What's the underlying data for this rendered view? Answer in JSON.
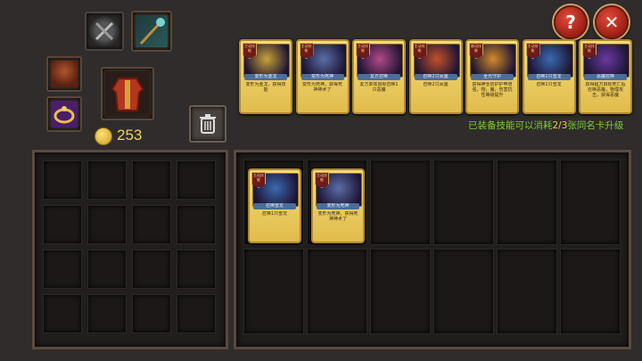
{
  "header": {
    "help_label": "?",
    "close_label": "✕"
  },
  "equipment": {
    "slots": [
      {
        "id": "weapon-slot-empty",
        "icon": "crossed-weapons-disabled-icon",
        "color": "#6f6f6f"
      },
      {
        "id": "weapon-slot-staff",
        "icon": "staff-icon",
        "color": "#3d7a7a"
      },
      {
        "id": "helmet-slot",
        "icon": "leather-helmet-icon",
        "color": "#8a3a22"
      },
      {
        "id": "armor-slot",
        "icon": "red-robe-armor-icon",
        "color": "#b3371f"
      },
      {
        "id": "ring-slot",
        "icon": "gold-ring-icon",
        "color": "#6a2c8c"
      }
    ],
    "gold_icon": "gold-coin-icon",
    "gold_amount": "253",
    "trash_icon": "trash-can-icon"
  },
  "skills_bar": {
    "cards": [
      {
        "tag": "主动技能",
        "title": "变形为金龙",
        "desc": "变形为金龙，获得技能",
        "art": "golden-dragon",
        "color": "#c7a23a"
      },
      {
        "tag": "主动技能",
        "title": "变形为死神",
        "desc": "变形为死神，获得死神神术了",
        "art": "death-knight",
        "color": "#5a6ea8"
      },
      {
        "tag": "主动技能",
        "title": "友方召唤",
        "desc": "友方单体目标召唤1只恶魔",
        "art": "pink-demon",
        "color": "#b24a88"
      },
      {
        "tag": "主动技能",
        "title": "召唤2只凤凰",
        "desc": "召唤2只凤凰",
        "art": "phoenix",
        "color": "#c4502a"
      },
      {
        "tag": "被动技能",
        "title": "圣光守护",
        "desc": "获得神圣防护护甲增强，物，魔，伤害抗性等级提升",
        "art": "holy-shield",
        "color": "#d18a2a"
      },
      {
        "tag": "主动技能",
        "title": "召唤1只雪龙",
        "desc": "召唤1只雪龙",
        "art": "snow-dragon",
        "color": "#3a6ab0"
      },
      {
        "tag": "主动技能",
        "title": "恶魔召唤",
        "desc": "获得敌方目标死亡后召唤恶魔，物理攻击，获得恶魔",
        "art": "purple-beast",
        "color": "#6a3aa0"
      }
    ]
  },
  "upgrade_hint": {
    "prefix": "已装备技能可以消耗",
    "count": "2/3",
    "suffix": "张同名卡升级",
    "color_green": "#7ecb3a",
    "color_yellow": "#f0d030"
  },
  "inventory": {
    "cards": [
      {
        "tag": "主动技能",
        "title": "召唤雪龙",
        "desc": "召唤1只雪龙",
        "art": "snow-dragon",
        "color": "#3a6ab0"
      },
      {
        "tag": "主动技能",
        "title": "变形为死神",
        "desc": "变形为死神，获得死神神术了",
        "art": "death-knight",
        "color": "#5a6ea8"
      }
    ]
  }
}
